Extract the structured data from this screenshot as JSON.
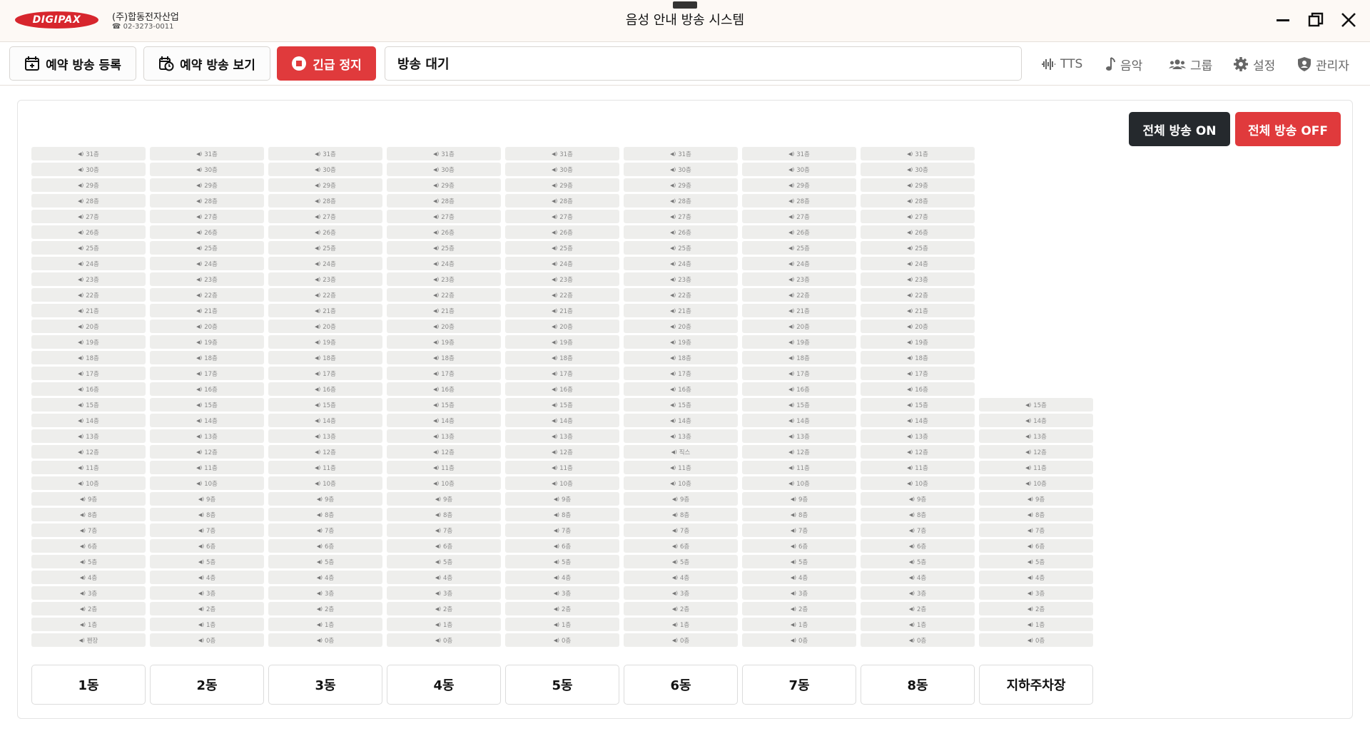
{
  "header": {
    "logo_text": "DIGIPAX",
    "company": "(주)합동전자산업",
    "phone": "☎ 02-3273-0011",
    "title": "음성 안내 방송 시스템"
  },
  "toolbar": {
    "reserve_register": "예약 방송 등록",
    "reserve_view": "예약 방송 보기",
    "emergency_stop": "긴급 정지",
    "status": "방송 대기",
    "nav": {
      "tts": "TTS",
      "music": "음악",
      "group": "그룹",
      "settings": "설정",
      "admin": "관리자"
    }
  },
  "controls": {
    "all_on": "전체 방송 ON",
    "all_off": "전체 방송 OFF"
  },
  "colors": {
    "accent_red": "#e03a3c",
    "dark": "#25292d",
    "zone_bg": "#eeeeec"
  },
  "icons": {
    "speaker": "speaker-icon"
  },
  "buildings": [
    {
      "name": "1동",
      "floors": [
        "31층",
        "30층",
        "29층",
        "28층",
        "27층",
        "26층",
        "25층",
        "24층",
        "23층",
        "22층",
        "21층",
        "20층",
        "19층",
        "18층",
        "17층",
        "16층",
        "15층",
        "14층",
        "13층",
        "12층",
        "11층",
        "10층",
        "9층",
        "8층",
        "7층",
        "6층",
        "5층",
        "4층",
        "3층",
        "2층",
        "1층",
        "펜장"
      ]
    },
    {
      "name": "2동",
      "floors": [
        "31층",
        "30층",
        "29층",
        "28층",
        "27층",
        "26층",
        "25층",
        "24층",
        "23층",
        "22층",
        "21층",
        "20층",
        "19층",
        "18층",
        "17층",
        "16층",
        "15층",
        "14층",
        "13층",
        "12층",
        "11층",
        "10층",
        "9층",
        "8층",
        "7층",
        "6층",
        "5층",
        "4층",
        "3층",
        "2층",
        "1층",
        "0층"
      ]
    },
    {
      "name": "3동",
      "floors": [
        "31층",
        "30층",
        "29층",
        "28층",
        "27층",
        "26층",
        "25층",
        "24층",
        "23층",
        "22층",
        "21층",
        "20층",
        "19층",
        "18층",
        "17층",
        "16층",
        "15층",
        "14층",
        "13층",
        "12층",
        "11층",
        "10층",
        "9층",
        "8층",
        "7층",
        "6층",
        "5층",
        "4층",
        "3층",
        "2층",
        "1층",
        "0층"
      ]
    },
    {
      "name": "4동",
      "floors": [
        "31층",
        "30층",
        "29층",
        "28층",
        "27층",
        "26층",
        "25층",
        "24층",
        "23층",
        "22층",
        "21층",
        "20층",
        "19층",
        "18층",
        "17층",
        "16층",
        "15층",
        "14층",
        "13층",
        "12층",
        "11층",
        "10층",
        "9층",
        "8층",
        "7층",
        "6층",
        "5층",
        "4층",
        "3층",
        "2층",
        "1층",
        "0층"
      ]
    },
    {
      "name": "5동",
      "floors": [
        "31층",
        "30층",
        "29층",
        "28층",
        "27층",
        "26층",
        "25층",
        "24층",
        "23층",
        "22층",
        "21층",
        "20층",
        "19층",
        "18층",
        "17층",
        "16층",
        "15층",
        "14층",
        "13층",
        "12층",
        "11층",
        "10층",
        "9층",
        "8층",
        "7층",
        "6층",
        "5층",
        "4층",
        "3층",
        "2층",
        "1층",
        "0층"
      ]
    },
    {
      "name": "6동",
      "floors": [
        "31층",
        "30층",
        "29층",
        "28층",
        "27층",
        "26층",
        "25층",
        "24층",
        "23층",
        "22층",
        "21층",
        "20층",
        "19층",
        "18층",
        "17층",
        "16층",
        "15층",
        "14층",
        "13층",
        "직스",
        "11층",
        "10층",
        "9층",
        "8층",
        "7층",
        "6층",
        "5층",
        "4층",
        "3층",
        "2층",
        "1층",
        "0층"
      ]
    },
    {
      "name": "7동",
      "floors": [
        "31층",
        "30층",
        "29층",
        "28층",
        "27층",
        "26층",
        "25층",
        "24층",
        "23층",
        "22층",
        "21층",
        "20층",
        "19층",
        "18층",
        "17층",
        "16층",
        "15층",
        "14층",
        "13층",
        "12층",
        "11층",
        "10층",
        "9층",
        "8층",
        "7층",
        "6층",
        "5층",
        "4층",
        "3층",
        "2층",
        "1층",
        "0층"
      ]
    },
    {
      "name": "8동",
      "floors": [
        "31층",
        "30층",
        "29층",
        "28층",
        "27층",
        "26층",
        "25층",
        "24층",
        "23층",
        "22층",
        "21층",
        "20층",
        "19층",
        "18층",
        "17층",
        "16층",
        "15층",
        "14층",
        "13층",
        "12층",
        "11층",
        "10층",
        "9층",
        "8층",
        "7층",
        "6층",
        "5층",
        "4층",
        "3층",
        "2층",
        "1층",
        "0층"
      ]
    },
    {
      "name": "지하주차장",
      "floors": [
        "15층",
        "14층",
        "13층",
        "12층",
        "11층",
        "10층",
        "9층",
        "8층",
        "7층",
        "6층",
        "5층",
        "4층",
        "3층",
        "2층",
        "1층",
        "0층"
      ]
    }
  ]
}
